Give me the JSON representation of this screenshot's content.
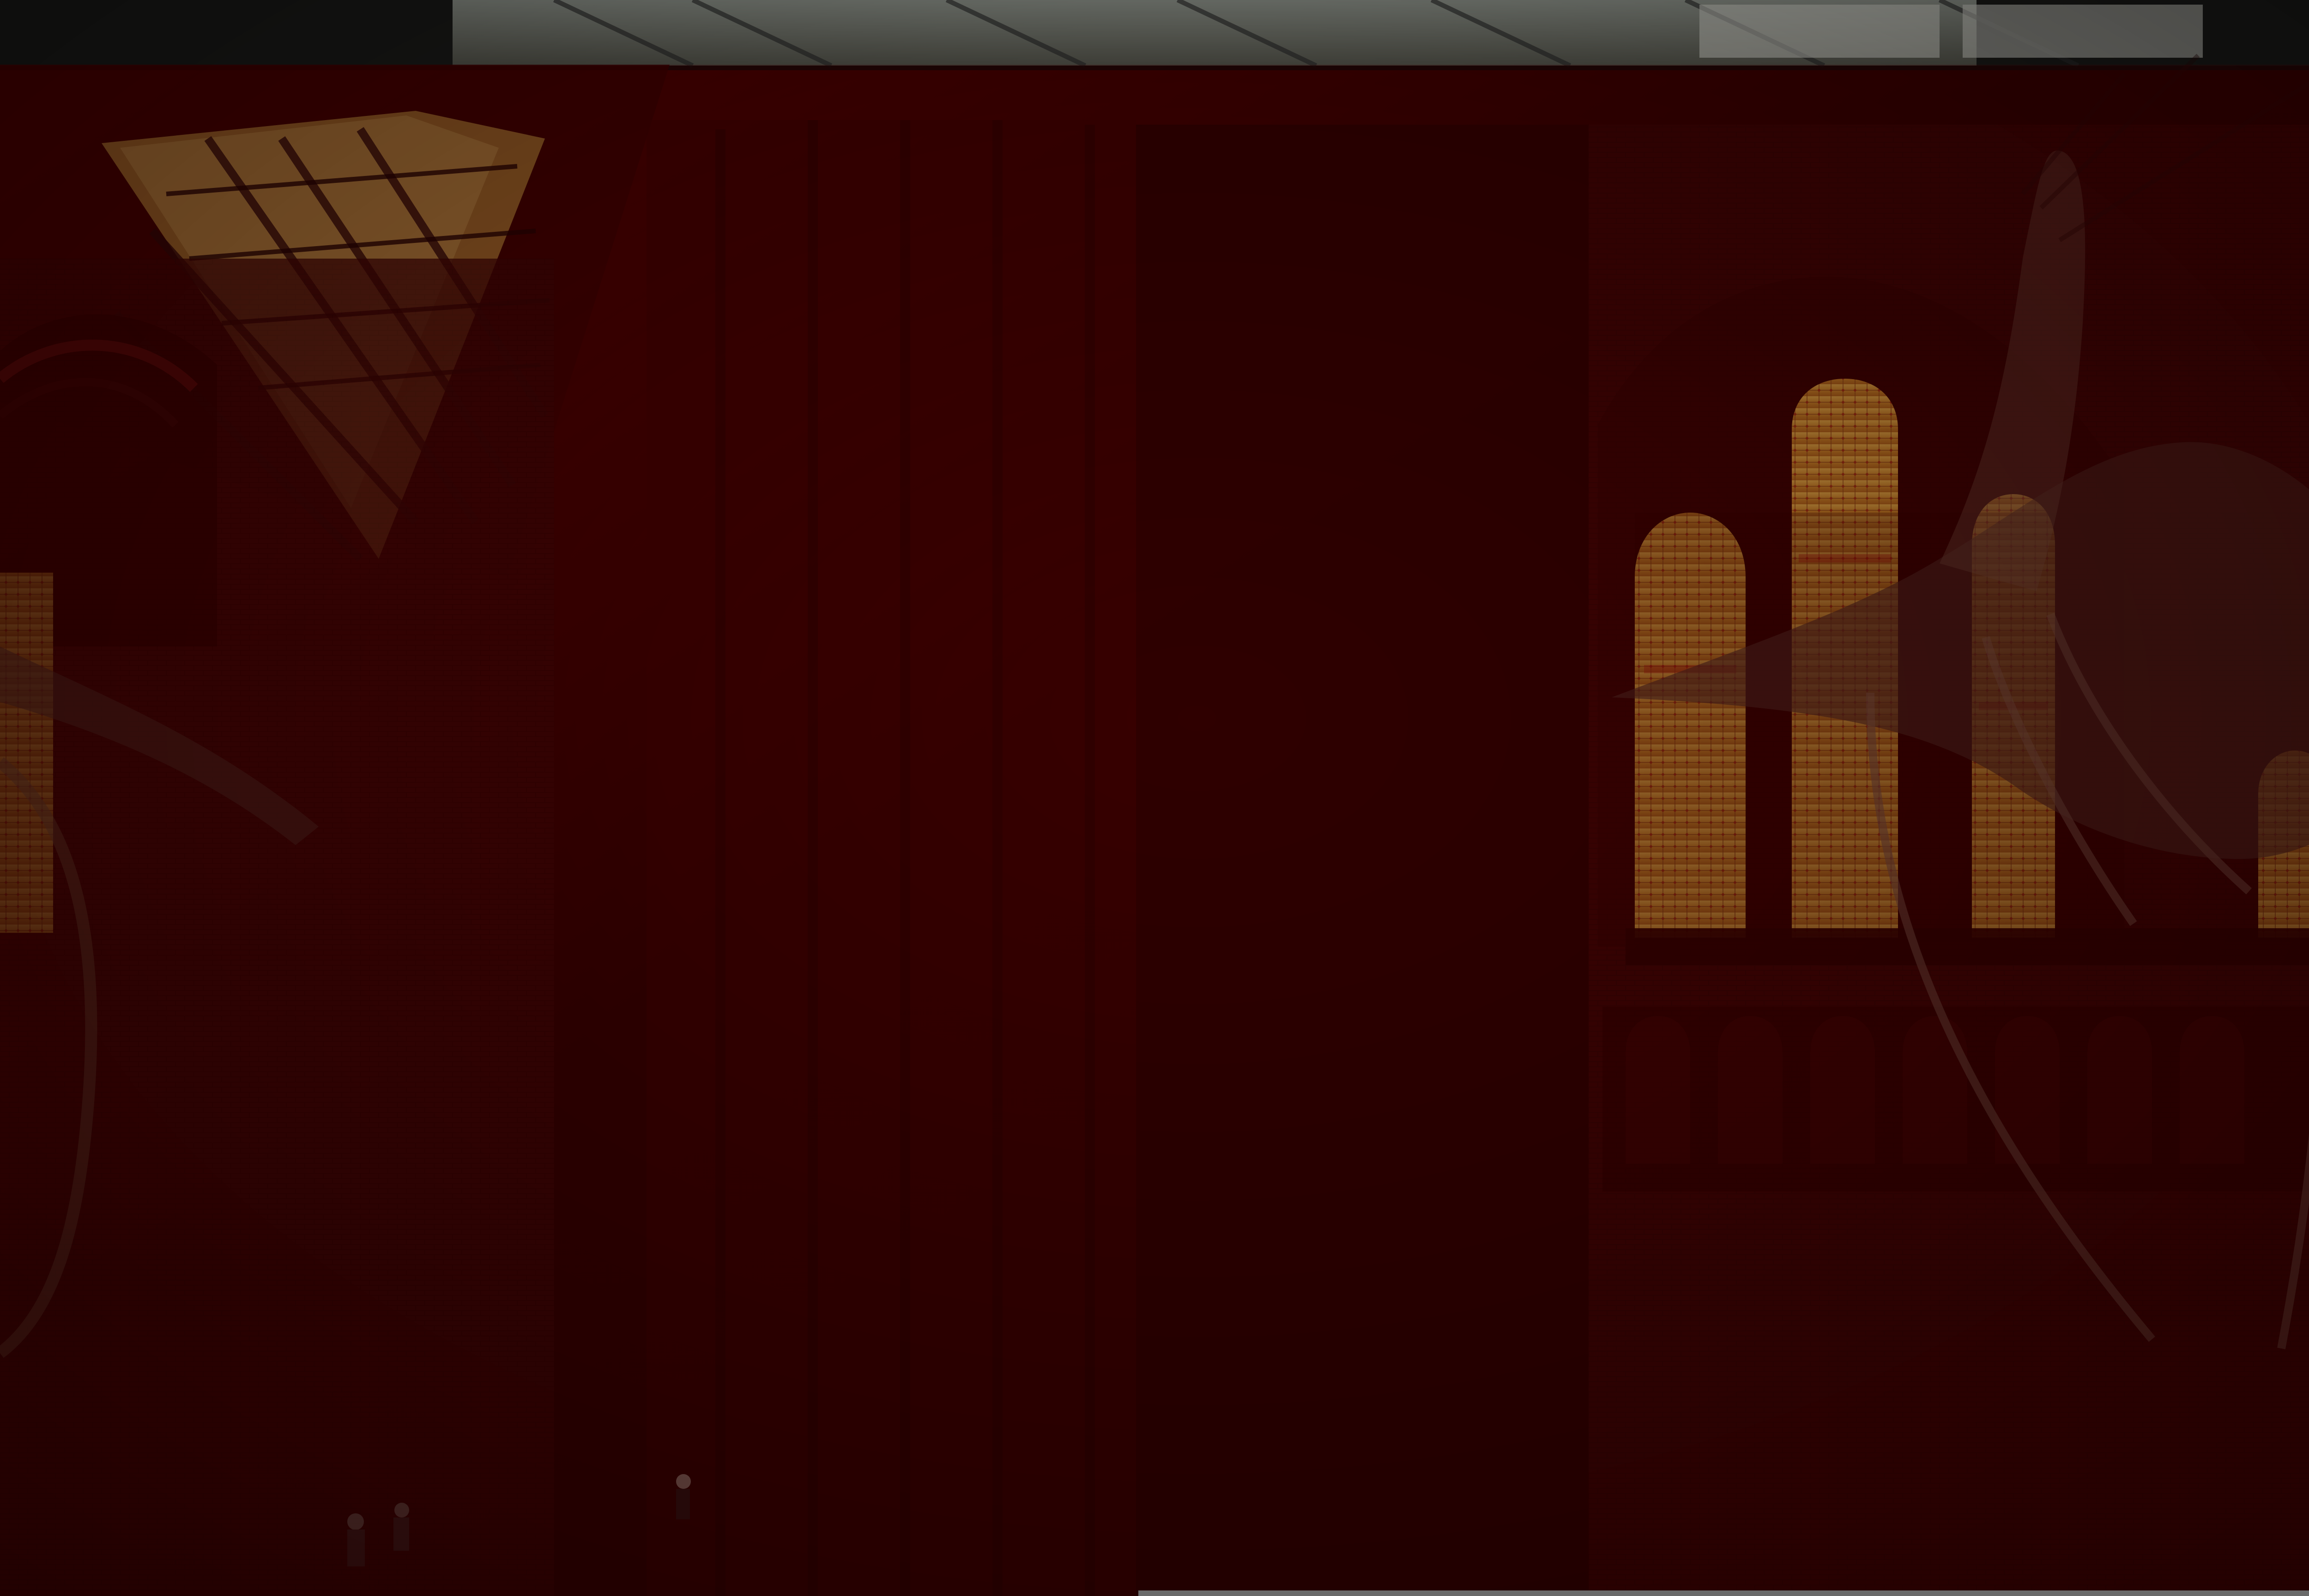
{
  "image": {
    "alt": "",
    "palette": {
      "sky": "#d8d8cf",
      "ironwork": "#2a2a2a",
      "dark_red": "#2b0000",
      "brick_red": "#4a0606",
      "warm_window": "#c78a2b",
      "window_red": "#a11212",
      "skeleton": "#5e3e2f",
      "strip_gray": "#6a6a6a"
    }
  }
}
